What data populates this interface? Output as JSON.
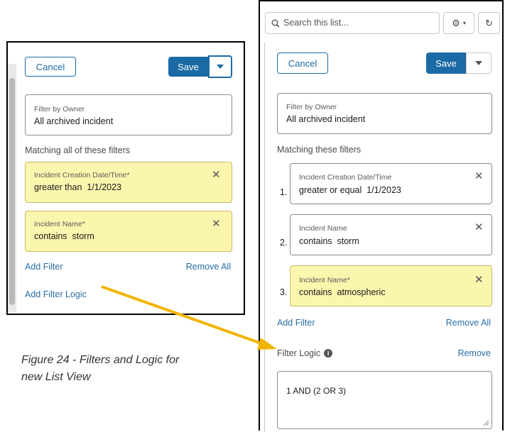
{
  "left_panel": {
    "cancel": "Cancel",
    "save": "Save",
    "owner_label": "Filter by Owner",
    "owner_value": "All archived incident",
    "matching_label": "Matching all of these filters",
    "filters": [
      {
        "field": "Incident Creation Date/Time*",
        "condition": "greater than  1/1/2023"
      },
      {
        "field": "Incident Name*",
        "condition": "contains  storm"
      }
    ],
    "add_filter": "Add Filter",
    "remove_all": "Remove All",
    "add_filter_logic": "Add Filter Logic"
  },
  "right_panel": {
    "search_placeholder": "Search this list...",
    "cancel": "Cancel",
    "save": "Save",
    "owner_label": "Filter by Owner",
    "owner_value": "All archived incident",
    "matching_label": "Matching these filters",
    "filters": [
      {
        "num": "1.",
        "field": "Incident Creation Date/Time",
        "condition": "greater or equal  1/1/2023"
      },
      {
        "num": "2.",
        "field": "Incident Name",
        "condition": "contains  storm"
      },
      {
        "num": "3.",
        "field": "Incident Name*",
        "condition": "contains  atmospheric"
      }
    ],
    "add_filter": "Add Filter",
    "remove_all": "Remove All",
    "filter_logic_label": "Filter Logic",
    "remove": "Remove",
    "logic_value": "1 AND (2 OR 3)"
  },
  "caption": {
    "line1": "Figure 24 - Filters and Logic for",
    "line2": "new List View"
  },
  "colors": {
    "brand_blue": "#1b6aa5",
    "highlight_yellow": "#fbf6ae",
    "arrow": "#f2b400"
  },
  "icons": [
    "search-icon",
    "gear-icon",
    "refresh-icon",
    "close-icon",
    "chevron-down-icon",
    "info-icon",
    "resize-handle-icon"
  ]
}
